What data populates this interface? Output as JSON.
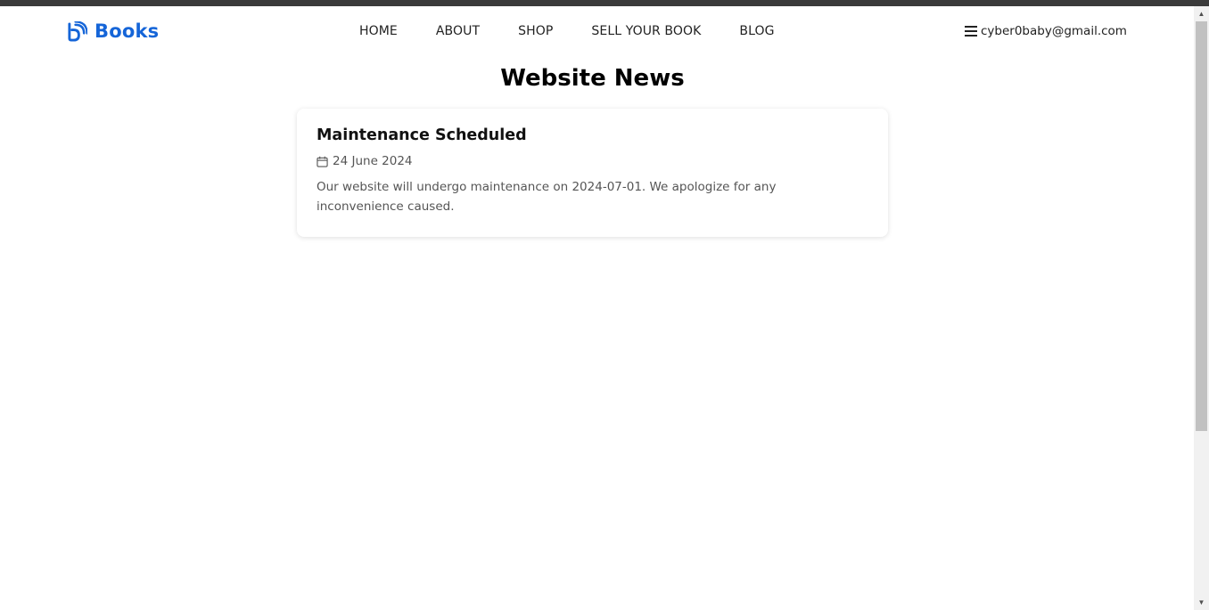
{
  "brand": {
    "name": "Books",
    "icon": "wifi-b-logo-icon",
    "color": "#1565d8"
  },
  "nav": {
    "items": [
      {
        "label": "HOME"
      },
      {
        "label": "ABOUT"
      },
      {
        "label": "SHOP"
      },
      {
        "label": "SELL YOUR BOOK"
      },
      {
        "label": "BLOG"
      }
    ]
  },
  "account": {
    "email": "cyber0baby@gmail.com",
    "icon": "hamburger-menu-icon"
  },
  "page": {
    "title": "Website News"
  },
  "news": [
    {
      "title": "Maintenance Scheduled",
      "date": "24 June 2024",
      "body": "Our website will undergo maintenance on 2024-07-01. We apologize for any inconvenience caused."
    }
  ],
  "scrollbar": {
    "up_glyph": "▲",
    "down_glyph": "▼"
  }
}
